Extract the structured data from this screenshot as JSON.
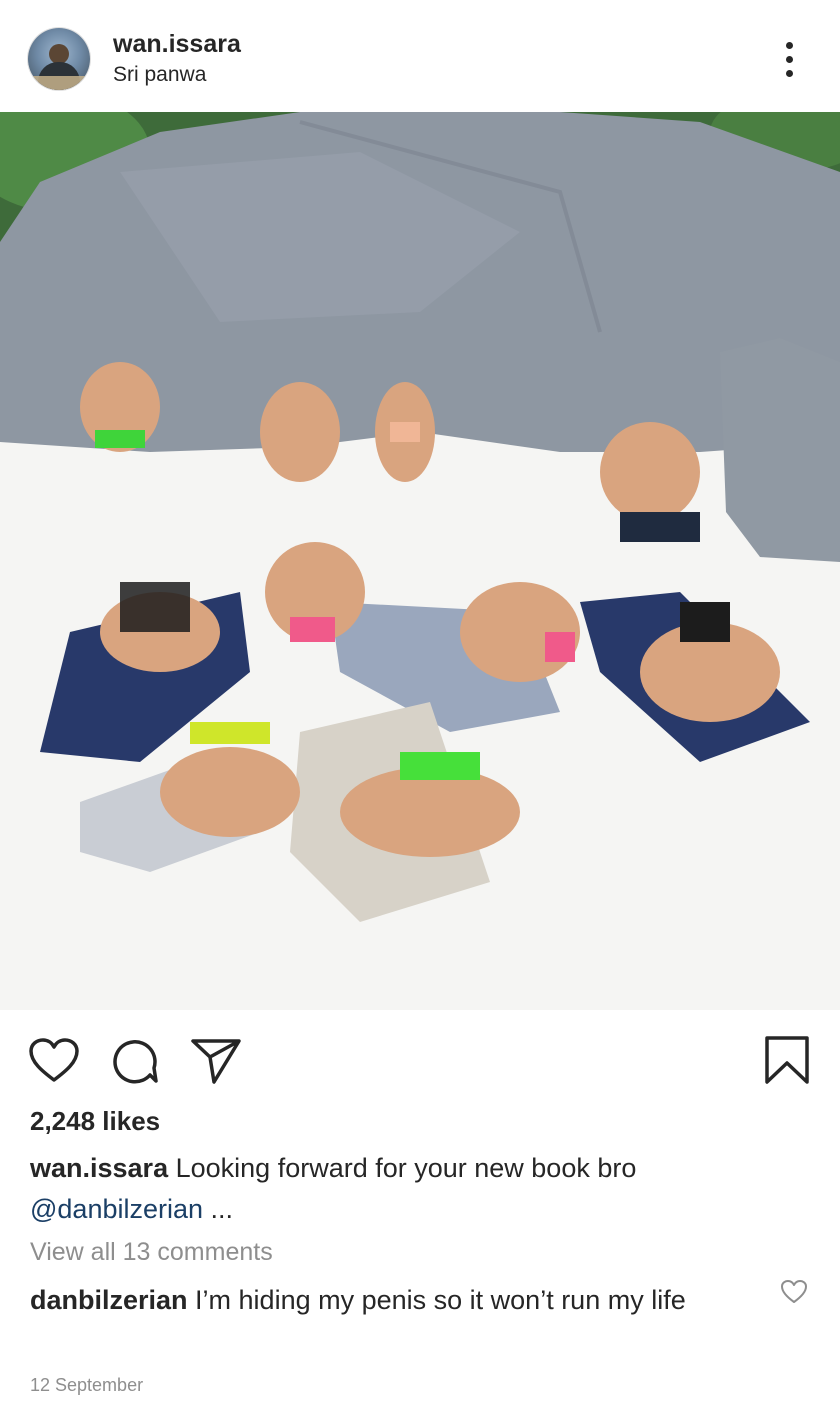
{
  "post": {
    "username": "wan.issara",
    "location": "Sri panwa",
    "likes_text": "2,248 likes",
    "caption_user": "wan.issara",
    "caption_text": "Looking forward for your new book bro",
    "caption_mention": "@danbilzerian",
    "caption_more": "...",
    "view_comments": "View all 13 comments",
    "comment_user": "danbilzerian",
    "comment_text": "I’m hiding my penis so it won’t run my life",
    "timestamp": "12 September"
  },
  "icons": {
    "more": "more-vertical-icon",
    "like": "heart-icon",
    "comment": "comment-bubble-icon",
    "share": "paper-plane-icon",
    "save": "bookmark-icon",
    "comment_like": "small-heart-icon"
  },
  "colors": {
    "text": "#262626",
    "secondary": "#8e8e8e",
    "mention": "#1b3f66"
  }
}
